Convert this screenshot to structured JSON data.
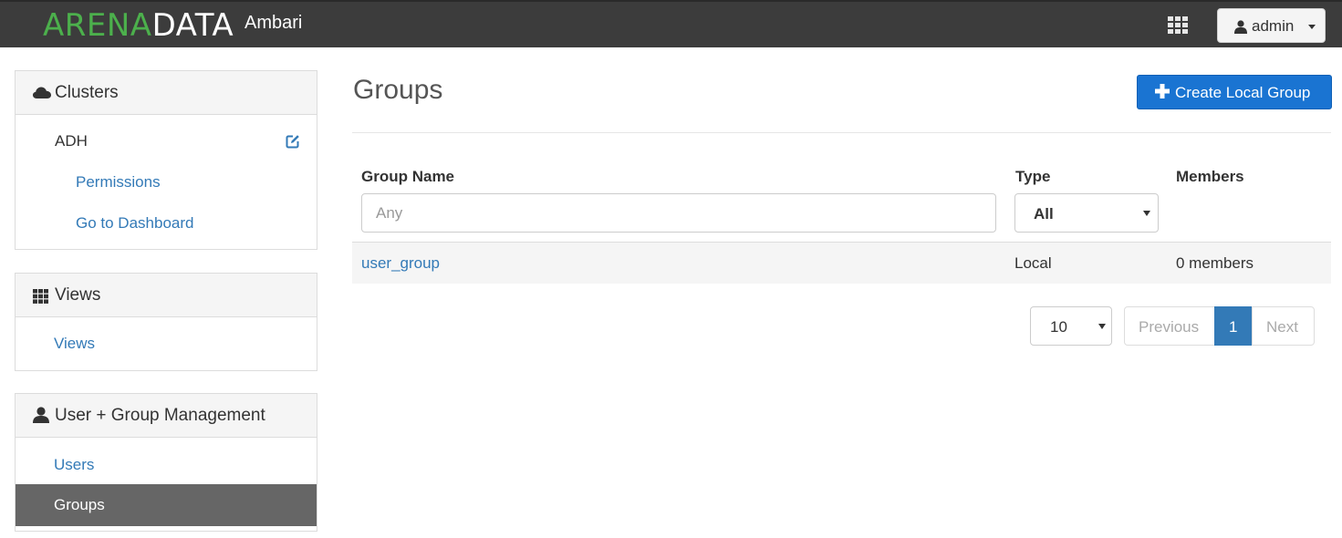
{
  "header": {
    "brand_part1": "ARENA",
    "brand_part2": "DATA",
    "app_name": "Ambari",
    "user_label": "admin",
    "brand_green": "#4cb04c"
  },
  "sidebar": {
    "clusters": {
      "title": "Clusters",
      "cluster_name": "ADH",
      "links": [
        "Permissions",
        "Go to Dashboard"
      ]
    },
    "views": {
      "title": "Views",
      "links": [
        "Views"
      ]
    },
    "user_management": {
      "title": "User + Group Management",
      "links": [
        "Users",
        "Groups"
      ],
      "active": "Groups"
    }
  },
  "main": {
    "title": "Groups",
    "create_button": "Create Local Group",
    "columns": [
      "Group Name",
      "Type",
      "Members"
    ],
    "filter": {
      "placeholder": "Any",
      "value": ""
    },
    "type_filter": "All",
    "rows": [
      {
        "name": "user_group",
        "type": "Local",
        "members": "0 members"
      }
    ],
    "pagination": {
      "page_size": "10",
      "previous": "Previous",
      "current_page": "1",
      "next": "Next"
    },
    "accent_color": "#337ab7",
    "primary_button_color": "#1a74d2"
  }
}
